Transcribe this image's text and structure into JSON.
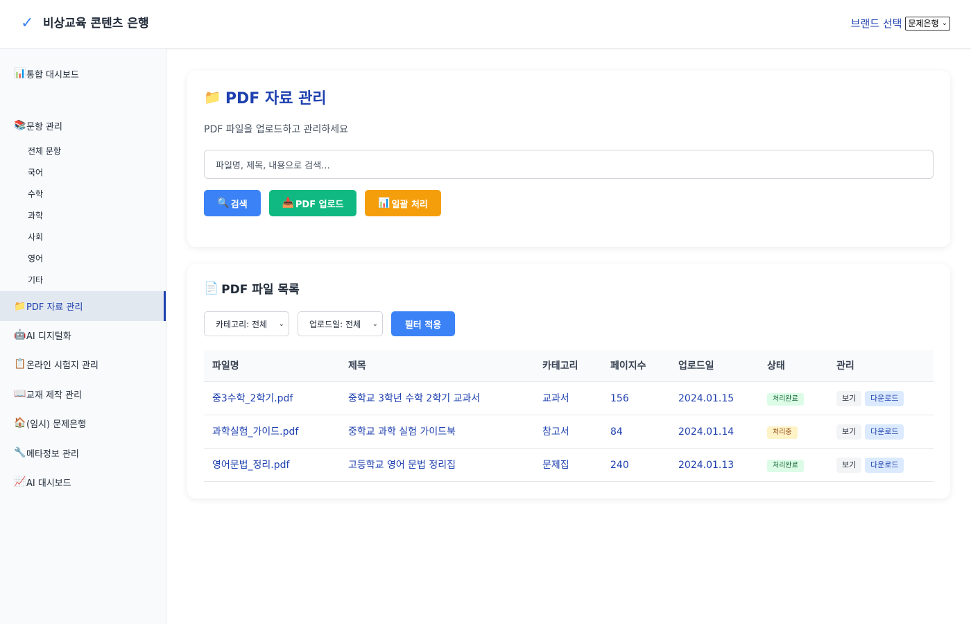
{
  "header": {
    "logo_icon": "check-icon",
    "title": "비상교육 콘텐츠 은행",
    "brand_label": "브랜드 선택",
    "brand_value": "문제은행"
  },
  "sidebar": {
    "dashboard": "통합 대시보드",
    "questions": "문항 관리",
    "sub_items": [
      "전체 문항",
      "국어",
      "수학",
      "과학",
      "사회",
      "영어",
      "기타"
    ],
    "pdf": "PDF 자료 관리",
    "ai_digital": "AI 디지털화",
    "online_exam": "온라인 시험지 관리",
    "textbook": "교재 제작 관리",
    "temp_bank": "(임시) 문제은행",
    "metadata": "메타정보 관리",
    "ai_dashboard": "AI 대시보드"
  },
  "pdf_manage": {
    "title": "PDF 자료 관리",
    "subtitle": "PDF 파일을 업로드하고 관리하세요",
    "search_placeholder": "파일명, 제목, 내용으로 검색...",
    "btn_search": "검색",
    "btn_upload": "PDF 업로드",
    "btn_batch": "일괄 처리"
  },
  "file_list": {
    "title": "PDF 파일 목록",
    "filter_category": "카테고리: 전체",
    "filter_date": "업로드일: 전체",
    "btn_filter": "필터 적용",
    "columns": [
      "파일명",
      "제목",
      "카테고리",
      "페이지수",
      "업로드일",
      "상태",
      "관리"
    ],
    "rows": [
      {
        "file": "중3수학_2학기.pdf",
        "title": "중학교 3학년 수학 2학기 교과서",
        "category": "교과서",
        "pages": "156",
        "date": "2024.01.15",
        "status": "처리완료",
        "view": "보기",
        "download": "다운로드"
      },
      {
        "file": "과학실험_가이드.pdf",
        "title": "중학교 과학 실험 가이드북",
        "category": "참고서",
        "pages": "84",
        "date": "2024.01.14",
        "status": "처리중",
        "view": "보기",
        "download": "다운로드"
      },
      {
        "file": "영어문법_정리.pdf",
        "title": "고등학교 영어 문법 정리집",
        "category": "문제집",
        "pages": "240",
        "date": "2024.01.13",
        "status": "처리완료",
        "view": "보기",
        "download": "다운로드"
      }
    ]
  },
  "colors": {
    "accent": "#1e40af",
    "primary_button": "#3b82f6",
    "upload_button": "#10b981",
    "batch_button": "#f59e0b"
  }
}
